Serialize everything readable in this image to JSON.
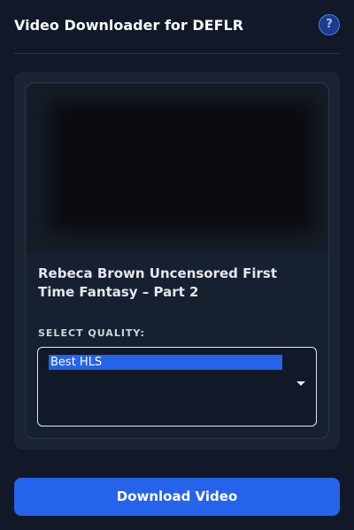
{
  "header": {
    "title": "Video Downloader for DEFLR",
    "help_label": "?"
  },
  "video": {
    "title": "Rebeca Brown Uncensored First Time Fantasy – Part 2"
  },
  "quality": {
    "label": "SELECT QUALITY:",
    "selected": "Best HLS"
  },
  "actions": {
    "download_label": "Download Video"
  },
  "colors": {
    "background": "#111827",
    "accent": "#2563eb"
  },
  "icons": {
    "help": "question-mark-icon",
    "dropdown": "chevron-down-icon"
  }
}
